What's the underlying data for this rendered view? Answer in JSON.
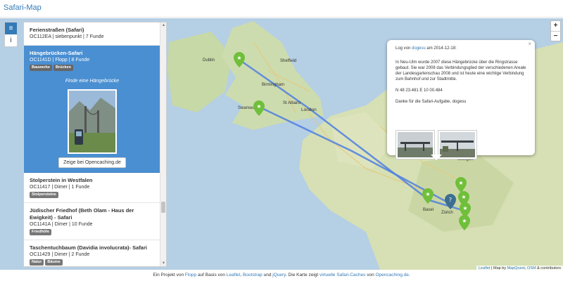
{
  "app": {
    "title": "Safari-Map"
  },
  "iconbar": {
    "list_icon": "≡",
    "info_icon": "i"
  },
  "sidebar": {
    "items": [
      {
        "title": "Ferienstraßen (Safari)",
        "meta": "OC112EA | siebenpunkt | 7 Funde",
        "tags": []
      },
      {
        "title": "Hängebrücken-Safari",
        "meta": "OC1141D | Flopp | 8 Funde",
        "tags": [
          "Bauwerke",
          "Brücken"
        ],
        "quote": "Finde eine Hängebrücke",
        "button": "Zeige bei Opencaching.de"
      },
      {
        "title": "Stolperstein in Westfalen",
        "meta": "OC11417 | Dimer | 1 Funde",
        "tags": [
          "Stolpersteine"
        ]
      },
      {
        "title": "Jüdischer Friedhof (Beth Olam - Haus der Ewigkeit) - Safari",
        "meta": "OC1141A | Dimer | 10 Funde",
        "tags": [
          "Friedhöfe"
        ]
      },
      {
        "title": "Taschentuchbaum (Davidia involucrata)- Safari",
        "meta": "OC11429 | Dimer | 2 Funde",
        "tags": [
          "Natur",
          "Bäume"
        ]
      }
    ]
  },
  "map": {
    "zoom_in": "+",
    "zoom_out": "−",
    "cities": [
      "Dublin",
      "Sheffield",
      "Birmingham",
      "St Albans",
      "London",
      "Swansea",
      "Stuttgart",
      "Basel",
      "Zürich"
    ],
    "route_color": "#4f7fe0",
    "marker_color": "#6fbf3a",
    "active_marker_color": "#3c6e8f"
  },
  "popup": {
    "close": "×",
    "log_prefix": "Log von",
    "user": "dogesu",
    "date_text": "am 2014-12-18:",
    "text1": "In Neu-Ulm wurde 2007 diese Hängebrücke über die Ringstrasse gebaut. Sie war 2008 das Verbindungsglied der verschiedenen Areale der Landesgartenschau 2008 und ist heute eine wichtige Verbindung zum Bahnhof und zur Stadtmitte.",
    "coords": "N 48 23.481 E 10 00.484",
    "thanks": "Danke für die Safari-Aufgabe, dogesu"
  },
  "attribution": {
    "leaflet": "Leaflet",
    "map_by": "| Map by",
    "mapquest": "MapQuest",
    "osm": "OSM",
    "contributors": "& contributors"
  },
  "footer": {
    "p1": "Ein Projekt von",
    "flopp": "Flopp",
    "p2": "auf Basis von",
    "leaflet": "Leaflet",
    "bootstrap": "Bootstrap",
    "p3": "und",
    "jquery": "jQuery",
    "p4": ". Die Karte zeigt",
    "virtual": "virtuelle Safari-Caches",
    "p5": "von",
    "opencaching": "Opencaching.de",
    "p6": "."
  }
}
